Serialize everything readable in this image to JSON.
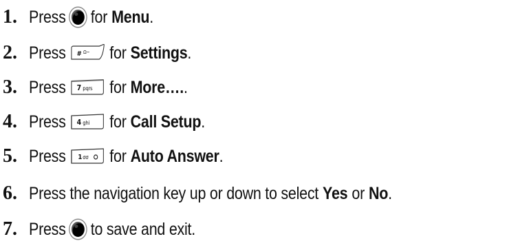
{
  "steps": [
    {
      "num": "1.",
      "pre": "Press",
      "key": "round",
      "mid": "for",
      "bold": "Menu",
      "post": "."
    },
    {
      "num": "2.",
      "pre": "Press",
      "key": "#",
      "key_label": "# Ω~",
      "mid": "for",
      "bold": "Settings",
      "post": "."
    },
    {
      "num": "3.",
      "pre": "Press",
      "key": "7",
      "key_label": "7pqrs",
      "mid": "for",
      "bold": "More….",
      "post": "."
    },
    {
      "num": "4.",
      "pre": "Press",
      "key": "4",
      "key_label": "4ghi",
      "mid": "for",
      "bold": "Call Setup",
      "post": "."
    },
    {
      "num": "5.",
      "pre": "Press",
      "key": "1",
      "key_label": "1σσ@",
      "mid": "for",
      "bold": "Auto Answer",
      "post": "."
    },
    {
      "num": "6.",
      "text_a": "Press the navigation key up or down to select",
      "bold_a": "Yes",
      "text_b": "or",
      "bold_b": "No",
      "post": "."
    },
    {
      "num": "7.",
      "pre": "Press",
      "key": "round",
      "mid": "to save and exit.",
      "bold": "",
      "post": ""
    }
  ]
}
